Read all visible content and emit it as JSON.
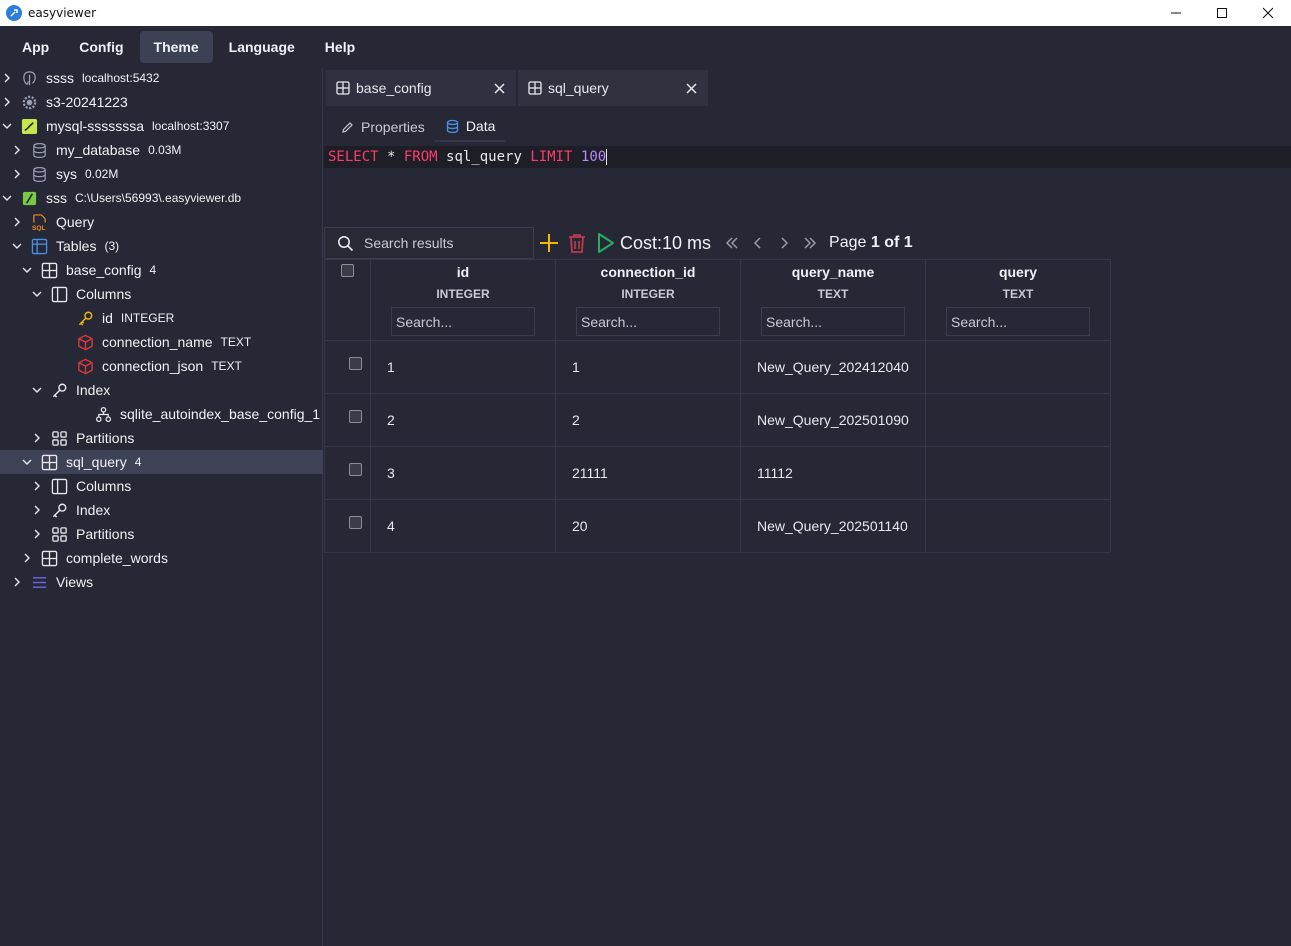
{
  "window": {
    "title": "easyviewer"
  },
  "menu": [
    "App",
    "Config",
    "Theme",
    "Language",
    "Help"
  ],
  "menu_active": "Theme",
  "tree": [
    {
      "label": "ssss",
      "meta": "localhost:5432",
      "icon": "postgres-icon",
      "indent": 0,
      "chevron": "right"
    },
    {
      "label": "s3-20241223",
      "meta": "",
      "icon": "gear-icon",
      "indent": 0,
      "chevron": "right"
    },
    {
      "label": "mysql-sssssssa",
      "meta": "localhost:3307",
      "icon": "mysql-icon",
      "indent": 0,
      "chevron": "down"
    },
    {
      "label": "my_database",
      "meta": "0.03M",
      "icon": "database-icon",
      "indent": 1,
      "chevron": "right"
    },
    {
      "label": "sys",
      "meta": "0.02M",
      "icon": "database-icon",
      "indent": 1,
      "chevron": "right"
    },
    {
      "label": "sss",
      "meta": "C:\\Users\\56993\\.easyviewer.db",
      "icon": "sqlite-icon",
      "indent": 0,
      "chevron": "down"
    },
    {
      "label": "Query",
      "meta": "",
      "icon": "sql-file-icon",
      "indent": 1,
      "chevron": "right"
    },
    {
      "label": "Tables",
      "meta": "(3)",
      "icon": "tables-icon",
      "indent": 1,
      "chevron": "down"
    },
    {
      "label": "base_config",
      "meta": "4",
      "icon": "table-icon",
      "indent": 2,
      "chevron": "down"
    },
    {
      "label": "Columns",
      "meta": "",
      "icon": "columns-icon",
      "indent": 3,
      "chevron": "down"
    },
    {
      "label": "id",
      "meta": "INTEGER",
      "icon": "key-icon",
      "indent": 4,
      "chevron": "none"
    },
    {
      "label": "connection_name",
      "meta": "TEXT",
      "icon": "cube-icon",
      "indent": 4,
      "chevron": "none"
    },
    {
      "label": "connection_json",
      "meta": "TEXT",
      "icon": "cube-icon",
      "indent": 4,
      "chevron": "none"
    },
    {
      "label": "Index",
      "meta": "",
      "icon": "index-key-icon",
      "indent": 3,
      "chevron": "down"
    },
    {
      "label": "sqlite_autoindex_base_config_1",
      "meta": "",
      "icon": "tree-structure-icon",
      "indent": 5,
      "chevron": "none"
    },
    {
      "label": "Partitions",
      "meta": "",
      "icon": "partitions-icon",
      "indent": 3,
      "chevron": "right"
    },
    {
      "label": "sql_query",
      "meta": "4",
      "icon": "table-icon",
      "indent": 2,
      "chevron": "down",
      "selected": true
    },
    {
      "label": "Columns",
      "meta": "",
      "icon": "columns-icon",
      "indent": 3,
      "chevron": "right"
    },
    {
      "label": "Index",
      "meta": "",
      "icon": "index-key-icon",
      "indent": 3,
      "chevron": "right"
    },
    {
      "label": "Partitions",
      "meta": "",
      "icon": "partitions-icon",
      "indent": 3,
      "chevron": "right"
    },
    {
      "label": "complete_words",
      "meta": "",
      "icon": "table-icon",
      "indent": 2,
      "chevron": "right"
    },
    {
      "label": "Views",
      "meta": "",
      "icon": "views-icon",
      "indent": 1,
      "chevron": "right"
    }
  ],
  "tabs": [
    {
      "label": "base_config"
    },
    {
      "label": "sql_query"
    }
  ],
  "subtabs": {
    "properties": "Properties",
    "data": "Data"
  },
  "sql": {
    "select": "SELECT",
    "star": " * ",
    "from": "FROM",
    "table": " sql_query ",
    "limit": "LIMIT",
    "num": " 100"
  },
  "toolbar": {
    "search_placeholder": "Search results",
    "cost": "Cost:10 ms",
    "page_prefix": "Page ",
    "page_bold": "1 of 1"
  },
  "grid": {
    "columns": [
      {
        "name": "id",
        "type": "INTEGER",
        "placeholder": "Search..."
      },
      {
        "name": "connection_id",
        "type": "INTEGER",
        "placeholder": "Search..."
      },
      {
        "name": "query_name",
        "type": "TEXT",
        "placeholder": "Search..."
      },
      {
        "name": "query",
        "type": "TEXT",
        "placeholder": "Search..."
      }
    ],
    "rows": [
      [
        "1",
        "1",
        "New_Query_202412040",
        ""
      ],
      [
        "2",
        "2",
        "New_Query_202501090",
        ""
      ],
      [
        "3",
        "21111",
        "11112",
        ""
      ],
      [
        "4",
        "20",
        "New_Query_202501140",
        ""
      ]
    ]
  },
  "colors": {
    "background": "#262835",
    "sql_keyword": "#ff3b6b",
    "sql_number": "#b987ff",
    "add": "#f5b800",
    "delete": "#c0394b",
    "run": "#27ae60"
  }
}
